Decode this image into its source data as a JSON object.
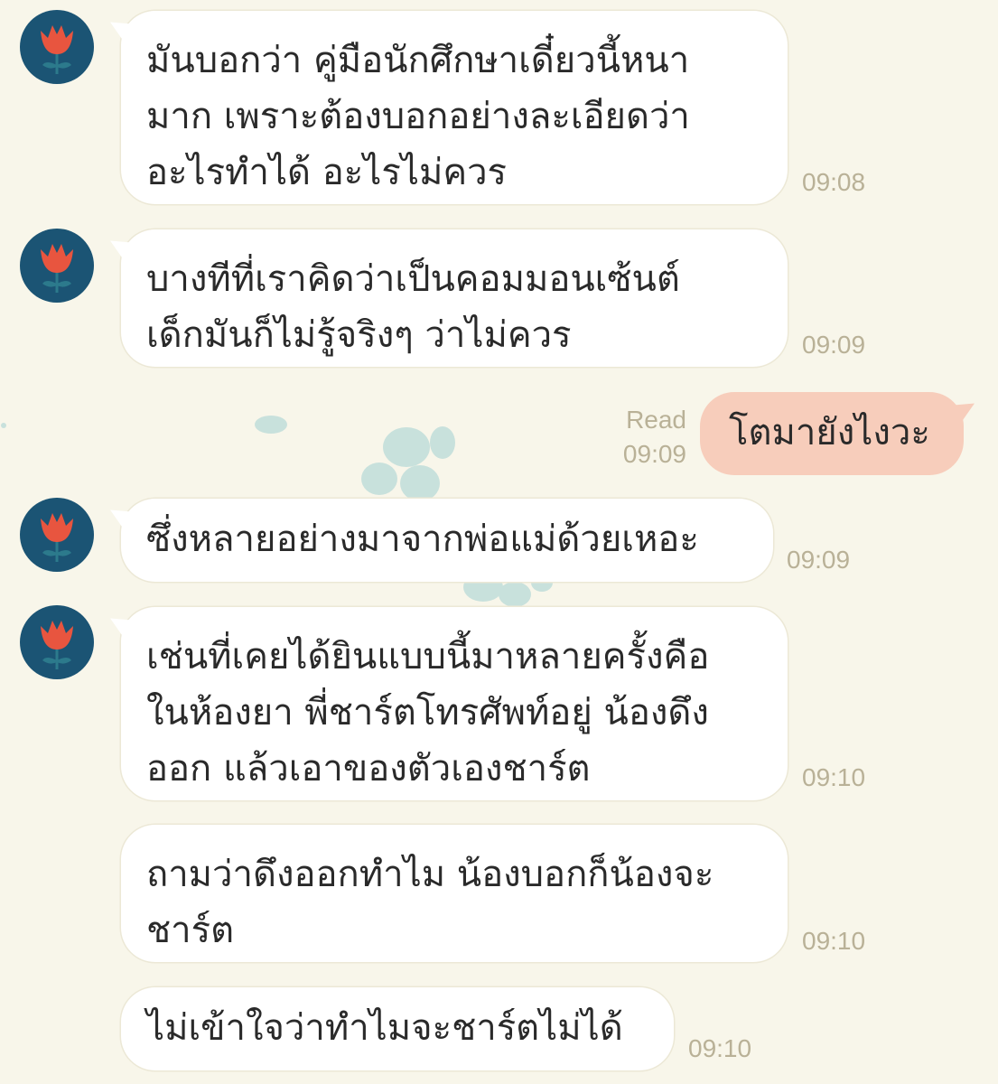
{
  "colors": {
    "background": "#f8f6ea",
    "incoming_bubble": "#ffffff",
    "outgoing_bubble": "#f7cdbb",
    "avatar_bg": "#1b5474",
    "avatar_flower": "#e8553f",
    "timestamp": "#b9b197"
  },
  "avatar_icon": "tulip-flower-icon",
  "messages": [
    {
      "direction": "incoming",
      "text": "มันบอกว่า คู่มือนักศึกษาเดี๋ยวนี้หนา\nมาก เพราะต้องบอกอย่างละเอียดว่า\nอะไรทำได้ อะไรไม่ควร",
      "time": "09:08"
    },
    {
      "direction": "incoming",
      "text": "บางทีที่เราคิดว่าเป็นคอมมอนเซ้นต์\nเด็กมันก็ไม่รู้จริงๆ ว่าไม่ควร",
      "time": "09:09"
    },
    {
      "direction": "outgoing",
      "text": "โตมายังไงวะ",
      "status": "Read",
      "time": "09:09"
    },
    {
      "direction": "incoming",
      "text": "ซึ่งหลายอย่างมาจากพ่อแม่ด้วยเหอะ",
      "time": "09:09"
    },
    {
      "direction": "incoming",
      "text": "เช่นที่เคยได้ยินแบบนี้มาหลายครั้งคือ\nในห้องยา พี่ชาร์ตโทรศัพท์อยู่ น้องดึง\nออก แล้วเอาของตัวเองชาร์ต",
      "time": "09:10"
    },
    {
      "direction": "incoming",
      "text": "ถามว่าดึงออกทำไม น้องบอกก็น้องจะ\nชาร์ต",
      "time": "09:10"
    },
    {
      "direction": "incoming",
      "text": "ไม่เข้าใจว่าทำไมจะชาร์ตไม่ได้",
      "time": "09:10"
    }
  ]
}
